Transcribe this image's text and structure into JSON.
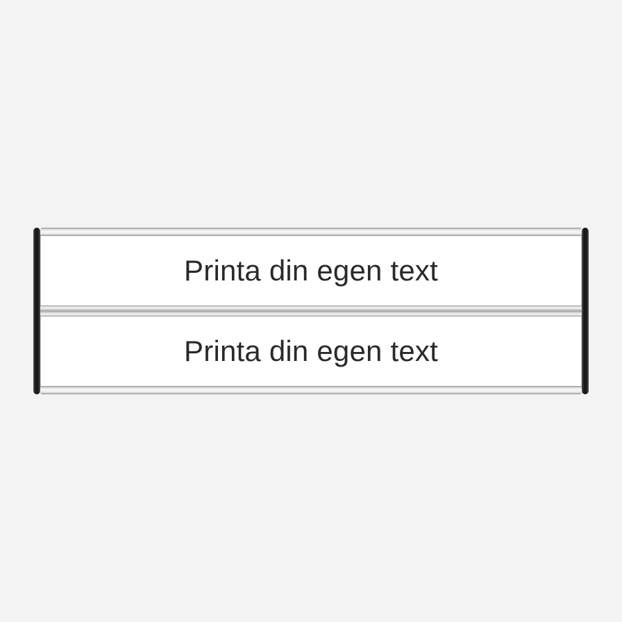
{
  "sign": {
    "panels": [
      {
        "text": "Printa din egen text"
      },
      {
        "text": "Printa din egen text"
      }
    ]
  }
}
